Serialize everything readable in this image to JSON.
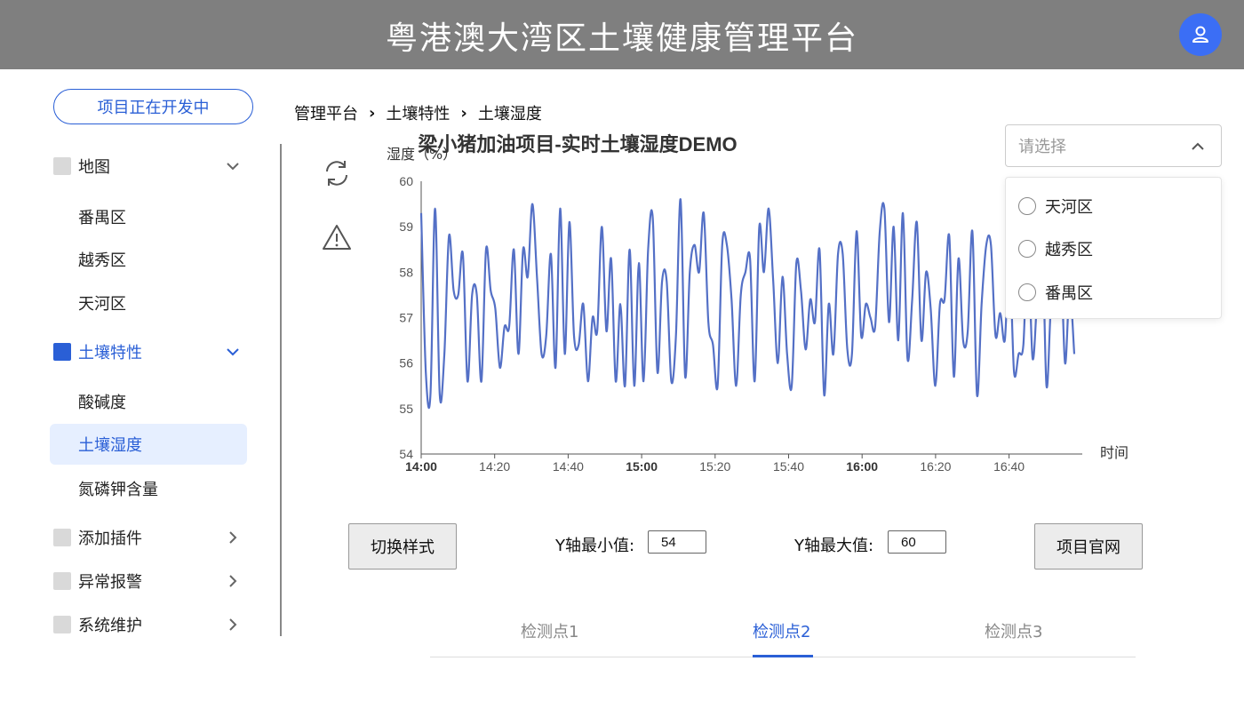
{
  "header": {
    "title": "粤港澳大湾区土壤健康管理平台",
    "avatar_icon": "user-icon"
  },
  "sidebar": {
    "dev_button": "项目正在开发中",
    "menus": [
      {
        "label": "地图",
        "expanded": true,
        "children": [
          "番禺区",
          "越秀区",
          "天河区"
        ]
      },
      {
        "label": "土壤特性",
        "expanded": true,
        "active": true,
        "children": [
          "酸碱度",
          "土壤湿度",
          "氮磷钾含量"
        ],
        "selected_child": "土壤湿度"
      },
      {
        "label": "添加插件",
        "expanded": false
      },
      {
        "label": "异常报警",
        "expanded": false
      },
      {
        "label": "系统维护",
        "expanded": false
      }
    ]
  },
  "breadcrumb": [
    "管理平台",
    "土壤特性",
    "土壤湿度"
  ],
  "select": {
    "placeholder": "请选择",
    "options": [
      "天河区",
      "越秀区",
      "番禺区"
    ]
  },
  "controls": {
    "switch_style": "切换样式",
    "ymin_label": "Y轴最小值:",
    "ymin_value": "54",
    "ymax_label": "Y轴最大值:",
    "ymax_value": "60",
    "website": "项目官网"
  },
  "tabs": [
    "检测点1",
    "检测点2",
    "检测点3"
  ],
  "active_tab": 1,
  "colors": {
    "accent": "#2a5fd6",
    "line": "#5470c6",
    "header": "#7f7f7f"
  },
  "chart_data": {
    "type": "line",
    "title": "梁小猪加油项目-实时土壤湿度DEMO",
    "ylabel": "湿度（%）",
    "xlabel": "时间",
    "ylim": [
      54,
      60
    ],
    "yticks": [
      "54",
      "55",
      "56",
      "57",
      "58",
      "59",
      "60"
    ],
    "xticks": [
      {
        "label": "14:00",
        "bold": true
      },
      {
        "label": "14:20",
        "bold": false
      },
      {
        "label": "14:40",
        "bold": false
      },
      {
        "label": "15:00",
        "bold": true
      },
      {
        "label": "15:20",
        "bold": false
      },
      {
        "label": "15:40",
        "bold": false
      },
      {
        "label": "16:00",
        "bold": true
      },
      {
        "label": "16:20",
        "bold": false
      },
      {
        "label": "16:40",
        "bold": false
      }
    ],
    "x_start_minute": 0,
    "x_end_minute": 118,
    "values": [
      59.3,
      55.8,
      55.3,
      59.4,
      55.3,
      56.2,
      58.8,
      57.6,
      57.5,
      58.4,
      55.6,
      57.5,
      57.5,
      55.6,
      58.5,
      57.6,
      57.2,
      55.9,
      56.8,
      56.8,
      58.5,
      56.2,
      58.5,
      57.9,
      59.5,
      57.9,
      56.2,
      56.6,
      58.4,
      55.9,
      59.4,
      56.2,
      59.1,
      56.6,
      56.4,
      57.3,
      55.6,
      57.0,
      56.7,
      59.0,
      56.7,
      58.3,
      55.6,
      57.3,
      55.5,
      58.5,
      55.5,
      58.2,
      55.6,
      58.5,
      59.2,
      55.8,
      57.8,
      57.8,
      55.6,
      56.6,
      59.6,
      55.7,
      58.0,
      58.6,
      58.0,
      59.3,
      56.9,
      56.4,
      55.5,
      58.6,
      58.6,
      57.4,
      55.5,
      57.5,
      58.0,
      58.3,
      55.6,
      59.0,
      58.0,
      59.4,
      57.8,
      56.0,
      57.9,
      56.2,
      55.5,
      58.2,
      57.6,
      56.3,
      57.4,
      56.9,
      58.5,
      55.3,
      57.3,
      56.2,
      58.4,
      58.4,
      56.3,
      56.2,
      58.9,
      56.6,
      57.3,
      57.0,
      56.8,
      58.9,
      59.4,
      56.9,
      59.0,
      56.5,
      59.3,
      56.1,
      57.4,
      59.1,
      56.5,
      58.0,
      57.2,
      55.5,
      57.3,
      57.4,
      58.8,
      55.7,
      58.3,
      56.5,
      56.7,
      58.9,
      55.3,
      57.3,
      58.6,
      58.6,
      56.6,
      57.1,
      56.5,
      58.3,
      55.8,
      56.2,
      56.4,
      58.6,
      56.1,
      57.5,
      59.2,
      55.5,
      57.3,
      57.1,
      58.6,
      56.0,
      57.6,
      56.2
    ]
  }
}
